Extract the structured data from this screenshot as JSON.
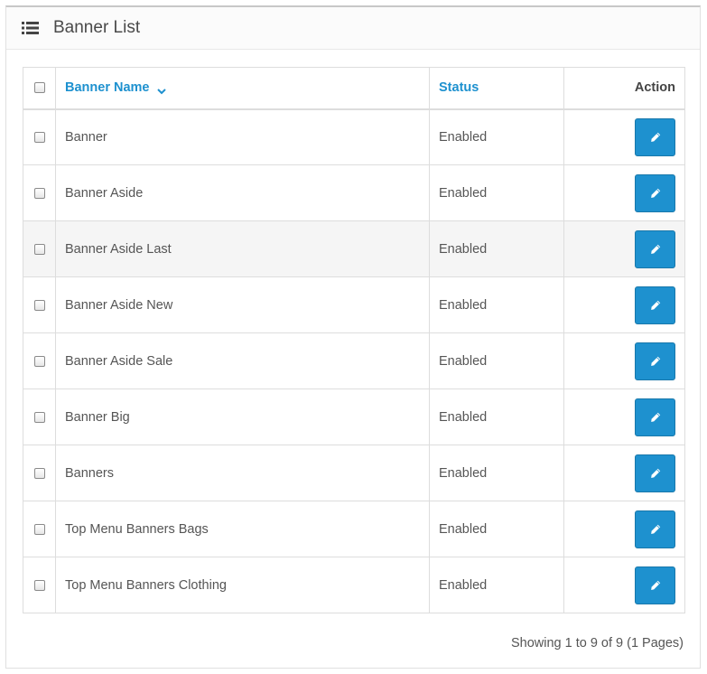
{
  "panel": {
    "title": "Banner List",
    "icon": "list-icon"
  },
  "table": {
    "columns": {
      "name": "Banner Name",
      "status": "Status",
      "action": "Action"
    },
    "sort": {
      "column": "Banner Name",
      "direction": "ascending"
    },
    "rows": [
      {
        "name": "Banner",
        "status": "Enabled"
      },
      {
        "name": "Banner Aside",
        "status": "Enabled"
      },
      {
        "name": "Banner Aside Last",
        "status": "Enabled"
      },
      {
        "name": "Banner Aside New",
        "status": "Enabled"
      },
      {
        "name": "Banner Aside Sale",
        "status": "Enabled"
      },
      {
        "name": "Banner Big",
        "status": "Enabled"
      },
      {
        "name": "Banners",
        "status": "Enabled"
      },
      {
        "name": "Top Menu Banners Bags",
        "status": "Enabled"
      },
      {
        "name": "Top Menu Banners Clothing",
        "status": "Enabled"
      }
    ],
    "edit_icon": "pencil-icon"
  },
  "pagination": {
    "text": "Showing 1 to 9 of 9 (1 Pages)"
  },
  "colors": {
    "primary": "#1e91cf",
    "text": "#555555",
    "border": "#dddddd"
  }
}
